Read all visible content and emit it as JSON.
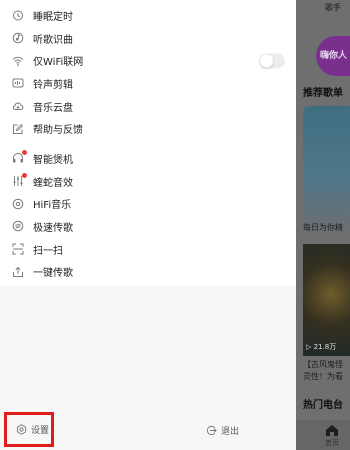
{
  "background_page": {
    "top_tab": "歌手",
    "avatar_text": "嗨你人",
    "section_recommended": "推荐歌单",
    "card1_text": "每日为你精",
    "card2_playcount": "▷ 21.8万",
    "card2_line1": "【古风鬼怪",
    "card2_line2": "灵性！为看",
    "section_hot": "热门电台",
    "home_label": "首页"
  },
  "menu": {
    "group1": [
      {
        "label": "睡眠定时",
        "icon": "alarm-clock-icon"
      },
      {
        "label": "听歌识曲",
        "icon": "music-recognize-icon"
      },
      {
        "label": "仅WiFi联网",
        "icon": "wifi-icon",
        "toggle": false
      },
      {
        "label": "铃声剪辑",
        "icon": "ringtone-icon"
      },
      {
        "label": "音乐云盘",
        "icon": "cloud-icon"
      },
      {
        "label": "帮助与反馈",
        "icon": "feedback-icon"
      }
    ],
    "group2": [
      {
        "label": "智能煲机",
        "icon": "headphone-icon",
        "badge": true
      },
      {
        "label": "蝰蛇音效",
        "icon": "equalizer-icon",
        "badge": true
      },
      {
        "label": "HiFi音乐",
        "icon": "hifi-icon"
      },
      {
        "label": "极速传歌",
        "icon": "transfer-icon"
      },
      {
        "label": "扫一扫",
        "icon": "scan-icon"
      },
      {
        "label": "一键传歌",
        "icon": "upload-icon"
      }
    ]
  },
  "footer": {
    "settings_label": "设置",
    "logout_label": "退出"
  },
  "colors": {
    "highlight_border": "#e01b1b",
    "badge": "#e83b3b",
    "overlay": "#6f6f6f"
  }
}
